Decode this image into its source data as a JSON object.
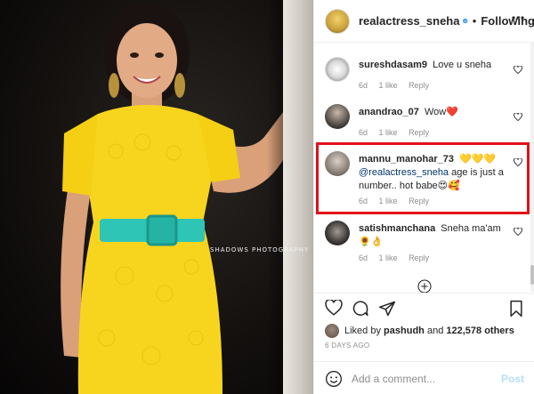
{
  "photo": {
    "watermark": "SHADOWS PHOTOGRAPHY"
  },
  "post": {
    "author": "realactress_sneha",
    "follow_status": "Following",
    "separator": "•"
  },
  "comments": [
    {
      "username": "sureshdasam9",
      "text": "Love u sneha",
      "age": "6d",
      "likes": "1 like",
      "reply": "Reply"
    },
    {
      "username": "anandrao_07",
      "text": "Wow❤️",
      "age": "6d",
      "likes": "1 like",
      "reply": "Reply"
    },
    {
      "username": "mannu_manohar_73",
      "text_suffix": " 💛💛💛",
      "mention": "@realactress_sneha",
      "text": " age is just a number.. hot babe😍🥰",
      "age": "6d",
      "likes": "1 like",
      "reply": "Reply"
    },
    {
      "username": "satishmanchana",
      "text": "Sneha ma'am 🌻👌",
      "age": "6d",
      "likes": "1 like",
      "reply": "Reply"
    }
  ],
  "likes": {
    "prefix": "Liked by",
    "user": "pashudh",
    "conjunction": "and",
    "others": "122,578 others"
  },
  "time_ago": "6 DAYS AGO",
  "add_comment": {
    "placeholder": "Add a comment...",
    "post_label": "Post"
  },
  "colors": {
    "highlight": "#e2101a",
    "verified": "#3897f0",
    "dress": "#f7d51e",
    "belt": "#2ec5b6"
  },
  "icons": {
    "like": "heart-icon",
    "comment": "comment-icon",
    "share": "share-icon",
    "save": "bookmark-icon",
    "more": "more-icon",
    "emoji": "emoji-icon",
    "load_more": "plus-circle-icon"
  }
}
